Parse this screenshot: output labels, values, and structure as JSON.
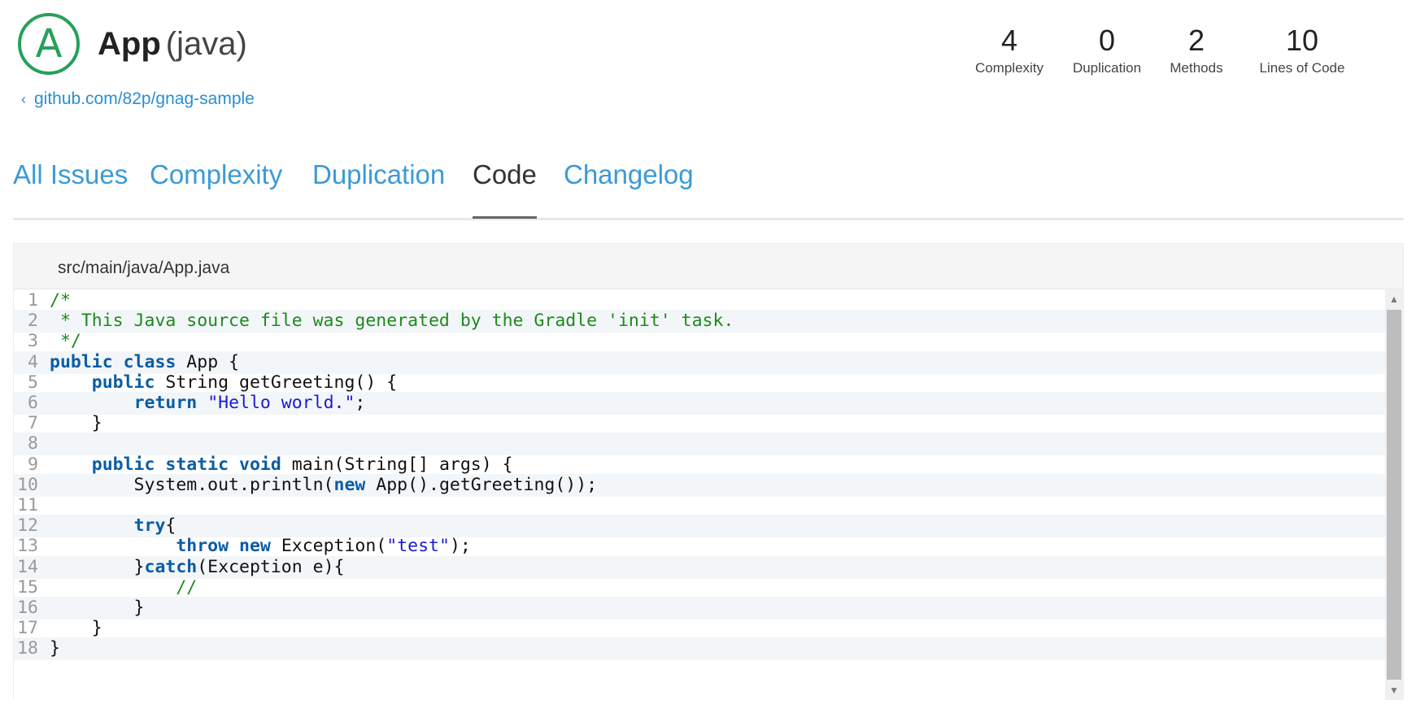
{
  "header": {
    "grade": "A",
    "app_name": "App",
    "language": "(java)",
    "repo_link": "github.com/82p/gnag-sample",
    "grade_color": "#27a05a"
  },
  "stats": [
    {
      "value": "4",
      "label": "Complexity"
    },
    {
      "value": "0",
      "label": "Duplication"
    },
    {
      "value": "2",
      "label": "Methods"
    },
    {
      "value": "10",
      "label": "Lines of Code"
    }
  ],
  "tabs": [
    {
      "label": "All Issues",
      "active": false
    },
    {
      "label": "Complexity",
      "active": false
    },
    {
      "label": "Duplication",
      "active": false
    },
    {
      "label": "Code",
      "active": true
    },
    {
      "label": "Changelog",
      "active": false
    }
  ],
  "file": {
    "path": "src/main/java/App.java",
    "lines": [
      "/*",
      " * This Java source file was generated by the Gradle 'init' task.",
      " */",
      "public class App {",
      "    public String getGreeting() {",
      "        return \"Hello world.\";",
      "    }",
      "",
      "    public static void main(String[] args) {",
      "        System.out.println(new App().getGreeting());",
      "",
      "        try{",
      "            throw new Exception(\"test\");",
      "        }catch(Exception e){",
      "            //",
      "        }",
      "    }",
      "}"
    ]
  },
  "colors": {
    "link": "#2a8fd0",
    "tab": "#3c9ad6",
    "keyword": "#0b5ca6",
    "string": "#1a1ad6",
    "comment": "#1d8a1d"
  },
  "icons": [
    "chevron-left-icon",
    "scroll-up-icon",
    "scroll-down-icon"
  ]
}
